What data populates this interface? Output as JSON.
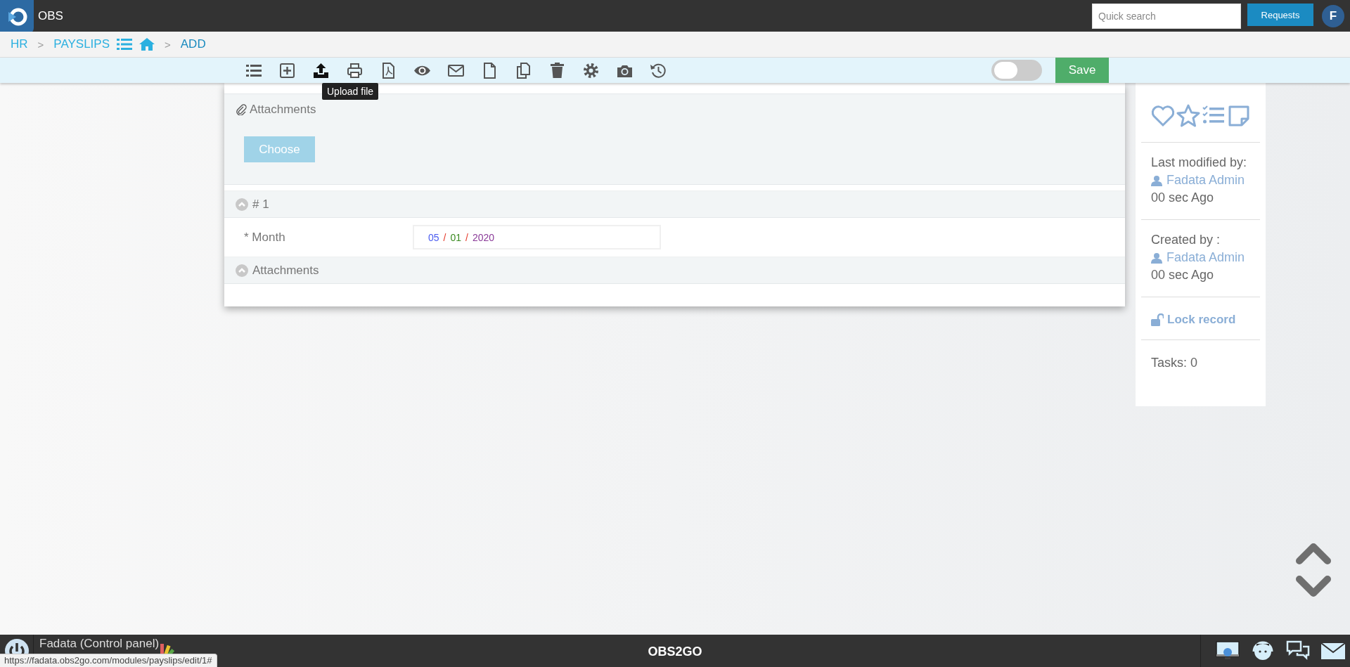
{
  "topbar": {
    "app_name": "OBS",
    "search": {
      "placeholder": "Quick search"
    },
    "requests_button": "Requests",
    "avatar": "F"
  },
  "breadcrumb": [
    {
      "kind": "link",
      "text": "HR"
    },
    {
      "kind": "separator",
      "text": ">"
    },
    {
      "kind": "link",
      "text": "PAYSLIPS"
    },
    {
      "kind": "list"
    },
    {
      "kind": "home"
    },
    {
      "kind": "separator",
      "text": ">"
    },
    {
      "kind": "current",
      "text": "ADD"
    }
  ],
  "toolbar": {
    "tooltip": "Upload file",
    "toggle": {
      "on": false
    },
    "save_button": "Save"
  },
  "form": {
    "attachments_panel": {
      "title": "Attachments",
      "button": "Choose"
    },
    "sections": [
      {
        "title": "# 1",
        "expanded": true,
        "fields": [
          {
            "label": "* Month",
            "value_parts": [
              "05",
              "/",
              "01",
              "/",
              "2020"
            ]
          }
        ]
      },
      {
        "title": "Attachments",
        "expanded": true
      }
    ]
  },
  "sidebar": {
    "blocks": [
      {
        "label": "Last modified by:",
        "user": "Fadata Admin",
        "time": "00 sec Ago"
      },
      {
        "label": "Created by :",
        "user": "Fadata Admin",
        "time": "00 sec Ago"
      }
    ],
    "lock_link": "Lock record",
    "tasks": "Tasks: 0"
  },
  "bottombar": {
    "company": "Fadata (Control panel)",
    "brand": "OBS2GO"
  },
  "status_url": "https://fadata.obs2go.com/modules/payslips/edit/1#"
}
